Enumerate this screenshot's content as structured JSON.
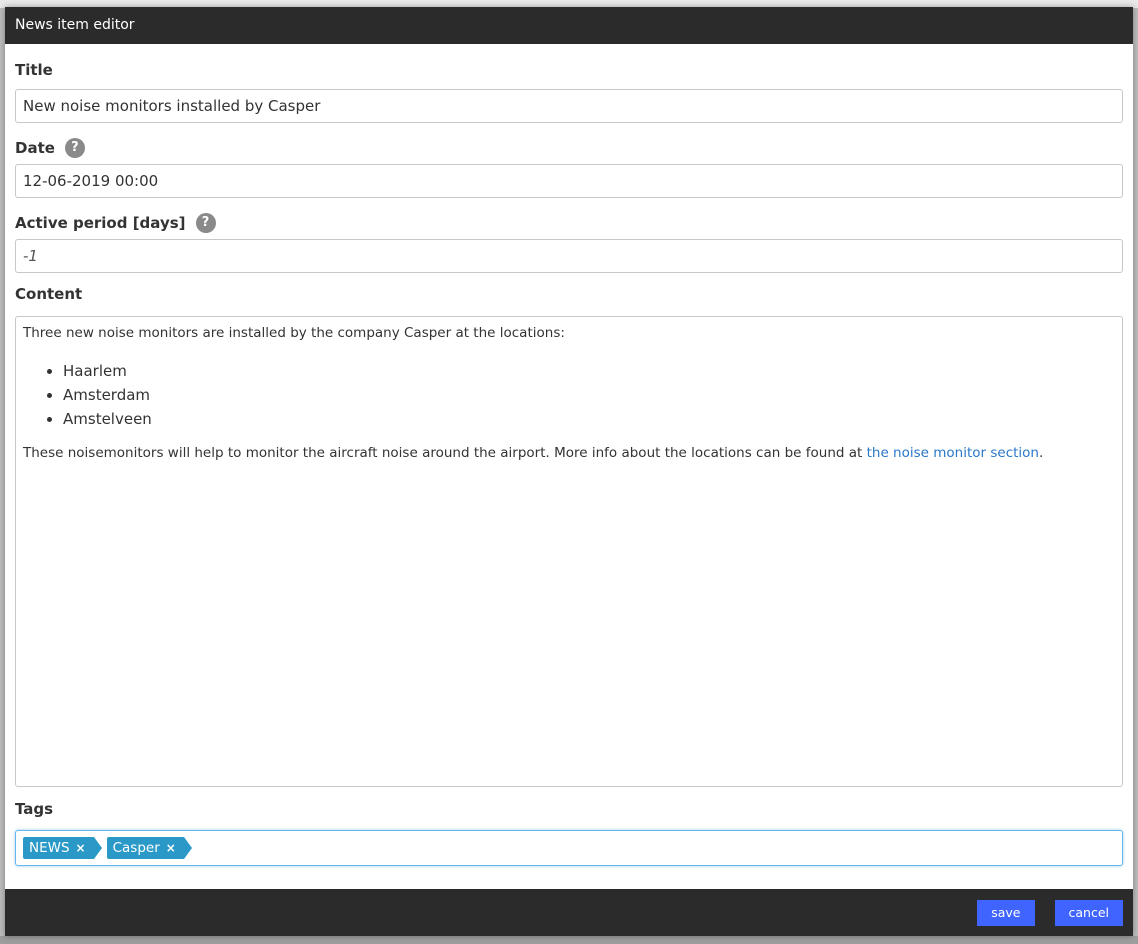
{
  "dialog": {
    "title": "News item editor"
  },
  "fields": {
    "title": {
      "label": "Title",
      "value": "New noise monitors installed by Casper"
    },
    "date": {
      "label": "Date",
      "value": "12-06-2019 00:00",
      "help": "?"
    },
    "active_period": {
      "label": "Active period [days]",
      "value": "-1",
      "help": "?"
    },
    "content": {
      "label": "Content",
      "intro": "Three new noise monitors are installed by the company Casper at the locations:",
      "locations": [
        "Haarlem",
        "Amsterdam",
        "Amstelveen"
      ],
      "outro": "These noisemonitors will help to monitor the aircraft noise around the airport. More info about the locations can be found at ",
      "link_text": "the noise monitor section",
      "trailing": "."
    },
    "tags": {
      "label": "Tags",
      "items": [
        {
          "label": "NEWS",
          "remove": "×"
        },
        {
          "label": "Casper",
          "remove": "×"
        }
      ]
    }
  },
  "footer": {
    "save_label": "save",
    "cancel_label": "cancel"
  },
  "colors": {
    "accent": "#3f64ff",
    "tag": "#2b99c8",
    "titlebar": "#2b2b2b",
    "link": "#2a78c8"
  },
  "icons": {
    "help": "help-icon",
    "tag_remove": "close-icon"
  }
}
